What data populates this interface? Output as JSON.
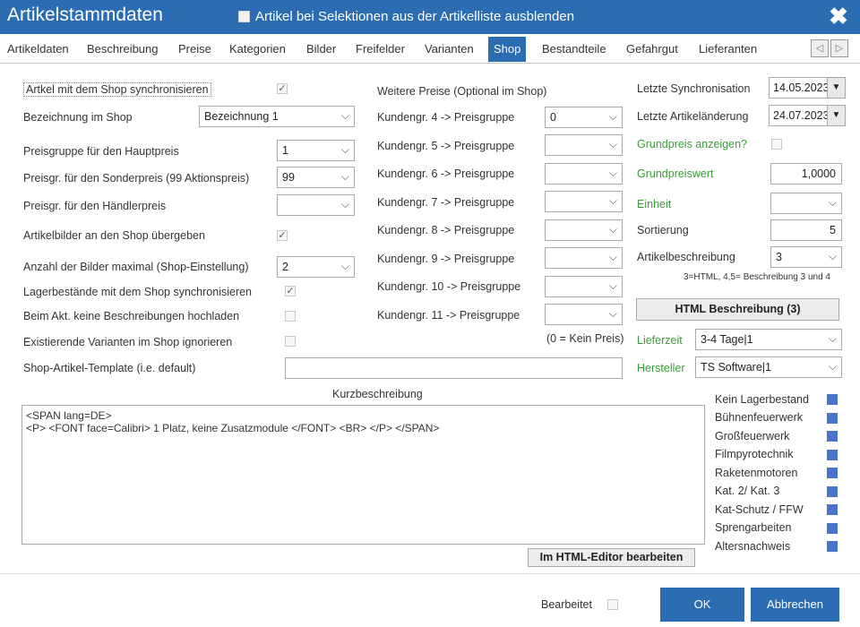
{
  "window": {
    "title": "Artikelstammdaten",
    "hide_checkbox_label": "Artikel bei Selektionen aus der Artikelliste ausblenden",
    "close": "✖"
  },
  "tabs": [
    "Artikeldaten",
    "Beschreibung",
    "Preise",
    "Kategorien",
    "Bilder",
    "Freifelder",
    "Varianten",
    "Shop",
    "Bestandteile",
    "Gefahrgut",
    "Lieferanten"
  ],
  "left": {
    "sync_label": "Artkel mit dem Shop synchronisieren",
    "bezeichnung_label": "Bezeichnung im Shop",
    "bezeichnung_value": "Bezeichnung 1",
    "hauptpreis_label": "Preisgruppe für den Hauptpreis",
    "hauptpreis_value": "1",
    "sonderpreis_label": "Preisgr. für den Sonderpreis (99 Aktionspreis)",
    "sonderpreis_value": "99",
    "haendlerpreis_label": "Preisgr. für den Händlerpreis",
    "haendlerpreis_value": "",
    "bilder_label": "Artikelbilder an den Shop übergeben",
    "anzahl_label": "Anzahl der Bilder maximal (Shop-Einstellung)",
    "anzahl_value": "2",
    "lager_label": "Lagerbestände mit dem Shop synchronisieren",
    "akt_label": "Beim Akt. keine Beschreibungen hochladen",
    "varianten_label": "Existierende Varianten im Shop ignorieren",
    "template_label": "Shop-Artikel-Template (i.e. default)",
    "template_value": ""
  },
  "mid": {
    "header": "Weitere Preise (Optional im Shop)",
    "rows": [
      {
        "label": "Kundengr. 4 -> Preisgruppe",
        "value": "0"
      },
      {
        "label": "Kundengr. 5 -> Preisgruppe",
        "value": ""
      },
      {
        "label": "Kundengr. 6 -> Preisgruppe",
        "value": ""
      },
      {
        "label": "Kundengr. 7 -> Preisgruppe",
        "value": ""
      },
      {
        "label": "Kundengr. 8 -> Preisgruppe",
        "value": ""
      },
      {
        "label": "Kundengr. 9 -> Preisgruppe",
        "value": ""
      },
      {
        "label": "Kundengr. 10 -> Preisgruppe",
        "value": ""
      },
      {
        "label": "Kundengr. 11 -> Preisgruppe",
        "value": ""
      }
    ],
    "note": "(0 = Kein Preis)"
  },
  "right": {
    "letzte_sync_label": "Letzte Synchronisation",
    "letzte_sync_value": "14.05.2023",
    "letzte_aend_label": "Letzte Artikeländerung",
    "letzte_aend_value": "24.07.2023",
    "grundpreis_label": "Grundpreis anzeigen?",
    "grundpreiswert_label": "Grundpreiswert",
    "grundpreiswert_value": "1,0000",
    "einheit_label": "Einheit",
    "einheit_value": "",
    "sortierung_label": "Sortierung",
    "sortierung_value": "5",
    "artbeschr_label": "Artikelbeschreibung",
    "artbeschr_value": "3",
    "artbeschr_hint": "3=HTML, 4,5= Beschreibung 3 und 4",
    "html_button": "HTML Beschreibung (3)",
    "lieferzeit_label": "Lieferzeit",
    "lieferzeit_value": "3-4 Tage|1",
    "hersteller_label": "Hersteller",
    "hersteller_value": "TS Software|1"
  },
  "kurz": {
    "label": "Kurzbeschreibung",
    "line1": "<SPAN lang=DE>",
    "line2": "<P> <FONT face=Calibri> 1 Platz, keine Zusatzmodule </FONT> <BR> </P> </SPAN>",
    "editor_button": "Im HTML-Editor bearbeiten"
  },
  "categories": [
    "Kein Lagerbestand",
    "Bühnenfeuerwerk",
    "Großfeuerwerk",
    "Filmpyrotechnik",
    "Raketenmotoren",
    "Kat. 2/ Kat. 3",
    "Kat-Schutz / FFW",
    "Sprengarbeiten",
    "Altersnachweis"
  ],
  "footer": {
    "bearbeitet_label": "Bearbeitet",
    "ok": "OK",
    "cancel": "Abbrechen"
  },
  "colors": {
    "accent": "#2b6cb3",
    "green_label": "#3a9a3a"
  }
}
